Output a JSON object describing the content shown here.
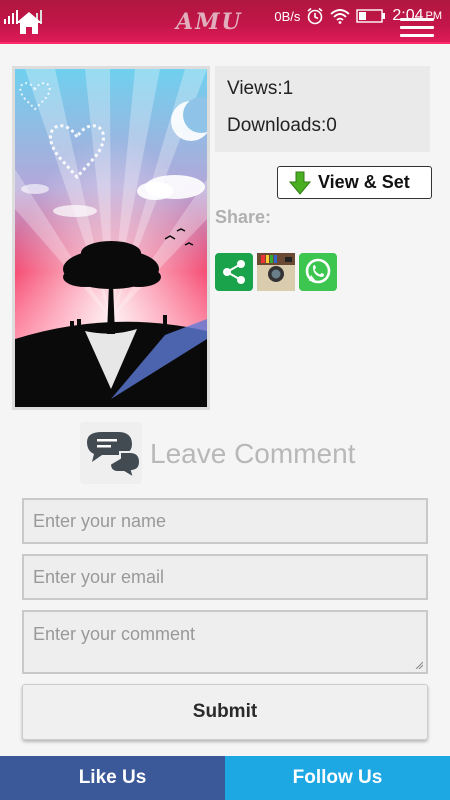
{
  "header": {
    "brand": "AMU",
    "status": {
      "data_rate": "0B/s",
      "time": "2:04",
      "ampm": "PM"
    }
  },
  "stats": {
    "views": "Views:1",
    "downloads": "Downloads:0"
  },
  "actions": {
    "view_set_label": "View & Set",
    "share_label": "Share:"
  },
  "share_icons": [
    "share-icon",
    "instagram-icon",
    "whatsapp-icon"
  ],
  "comment": {
    "title": "Leave Comment",
    "name_placeholder": "Enter your name",
    "email_placeholder": "Enter your email",
    "comment_placeholder": "Enter your comment",
    "submit_label": "Submit"
  },
  "footer": {
    "like_label": "Like Us",
    "follow_label": "Follow Us"
  },
  "colors": {
    "header": "#c31649",
    "like": "#3b5998",
    "follow": "#1da7e3",
    "share_green": "#1aa34a",
    "whatsapp_green": "#3cc650"
  }
}
